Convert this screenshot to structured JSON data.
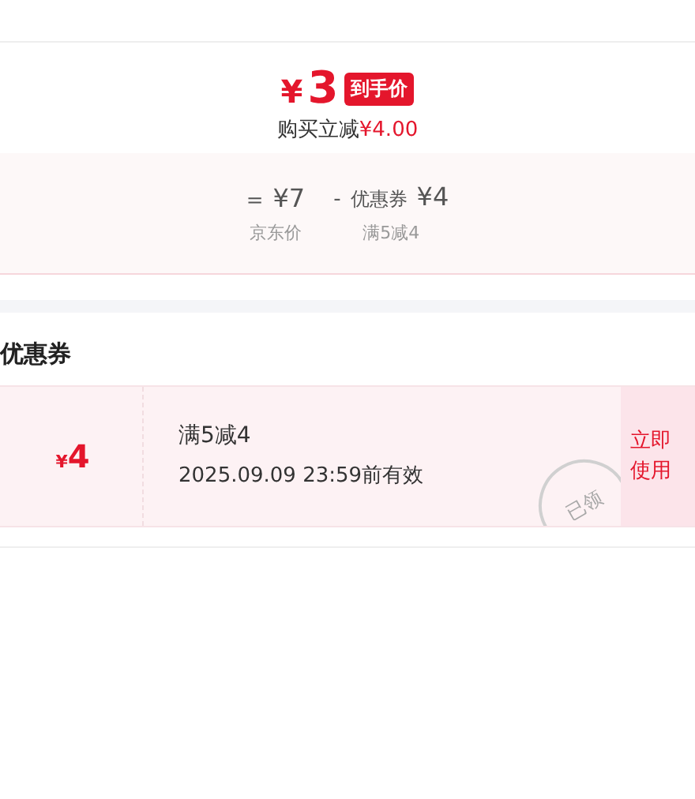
{
  "price": {
    "symbol": "¥",
    "amount": "3",
    "tag": "到手价"
  },
  "discount": {
    "label": "购买立减",
    "amount": "¥4.00"
  },
  "formula": [
    {
      "op": "=",
      "value": "¥7",
      "caption": "京东价"
    },
    {
      "op": "-",
      "name": "优惠券",
      "value": "¥4",
      "caption": "满5减4"
    }
  ],
  "coupons_title": "优惠券",
  "coupon": {
    "symbol": "¥",
    "amount": "4",
    "rule": "满5减4",
    "validity": "2025.09.09 23:59前有效",
    "stamp": "已领",
    "action": "立即使用"
  }
}
